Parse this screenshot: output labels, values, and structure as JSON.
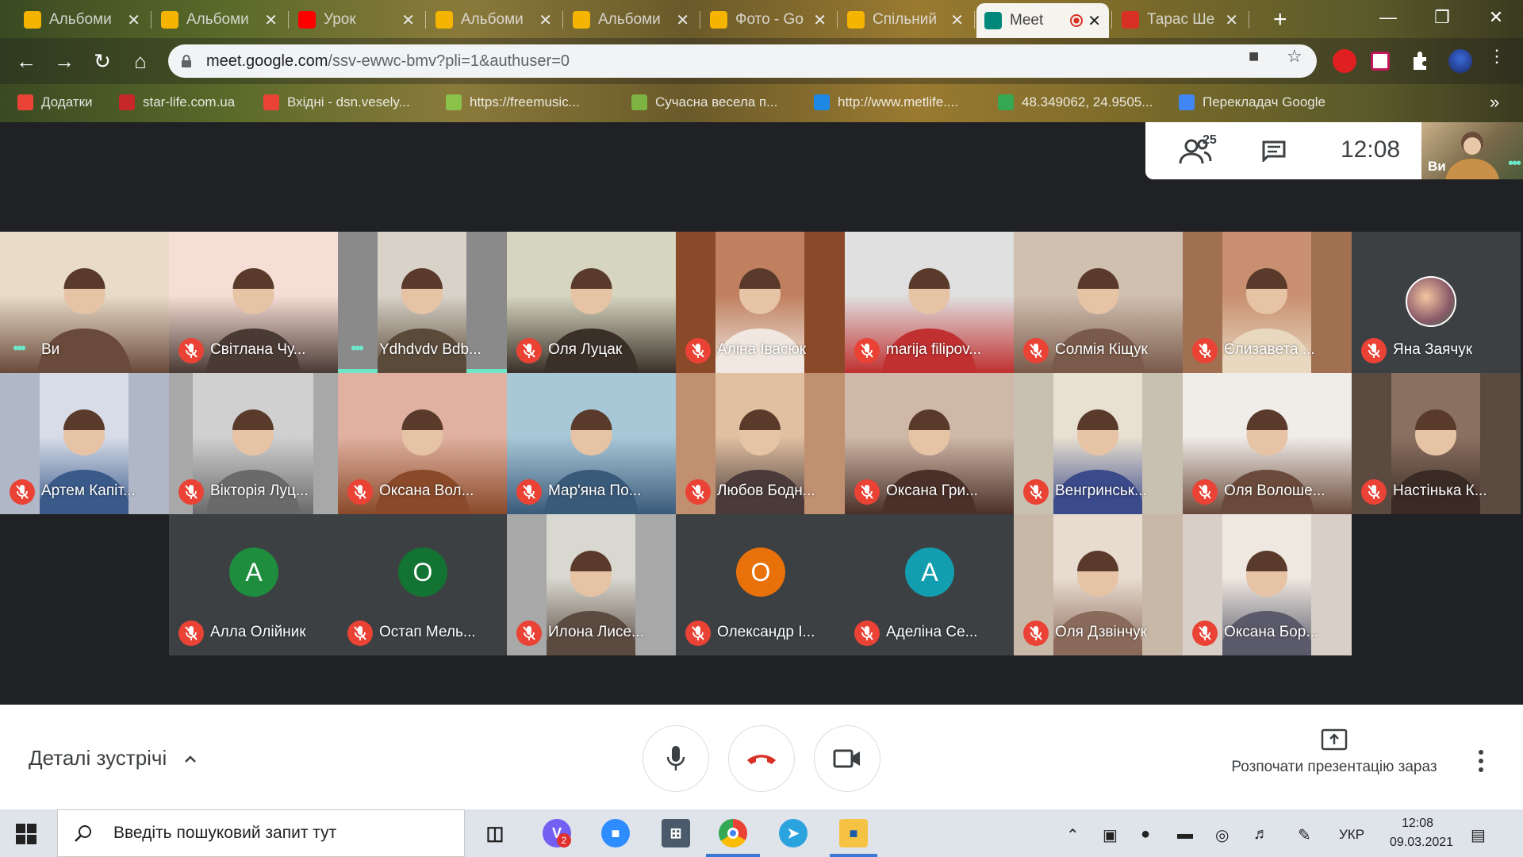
{
  "browser": {
    "tabs": [
      {
        "title": "Альбоми",
        "color": "#f4b400"
      },
      {
        "title": "Альбоми",
        "color": "#f4b400"
      },
      {
        "title": "Урок",
        "color": "#ff0000"
      },
      {
        "title": "Альбоми",
        "color": "#f4b400"
      },
      {
        "title": "Альбоми",
        "color": "#f4b400"
      },
      {
        "title": "Фото - Go",
        "color": "#f4b400"
      },
      {
        "title": "Спільний",
        "color": "#f4b400"
      },
      {
        "title": "Meet",
        "color": "#00897b"
      },
      {
        "title": "Тарас Ше",
        "color": "#d93025"
      }
    ],
    "url_host": "meet.google.com",
    "url_path": "/ssv-ewwc-bmv?pli=1&authuser=0",
    "bookmarks": [
      {
        "label": "Додатки",
        "color": "#ea4335"
      },
      {
        "label": "star-life.com.ua",
        "color": "#c62828"
      },
      {
        "label": "Вхідні - dsn.vesely...",
        "color": "#ea4335"
      },
      {
        "label": "https://freemusic...",
        "color": "#8bc34a"
      },
      {
        "label": "Сучасна весела п...",
        "color": "#7cb342"
      },
      {
        "label": "http://www.metlife....",
        "color": "#1e88e5"
      },
      {
        "label": "48.349062, 24.9505...",
        "color": "#34a853"
      },
      {
        "label": "Перекладач Google",
        "color": "#4285f4"
      }
    ],
    "bookmarks_more": "»"
  },
  "meet": {
    "participant_count": "25",
    "time": "12:08",
    "self_label": "Ви",
    "tiles": [
      {
        "name": "Ви",
        "muted": false,
        "self": true,
        "bg": "#b9a78a",
        "vw": 213,
        "vx": 0,
        "c1": "#e8dcc8",
        "c2": "#6a4a3a"
      },
      {
        "name": "Світлана Чу...",
        "muted": true,
        "bg": "#f0d2cc",
        "vw": 213,
        "vx": 0,
        "c1": "#f6ded6",
        "c2": "#4a3a34"
      },
      {
        "name": "Ydhdvdv Bdb...",
        "muted": false,
        "speaking": true,
        "bg": "#8a8a8a",
        "vw": 112,
        "vx": 50,
        "c1": "#d8d2c8",
        "c2": "#5a4a3a"
      },
      {
        "name": "Оля Луцак",
        "muted": true,
        "bg": "#c8c8b0",
        "vw": 213,
        "vx": 0,
        "c1": "#d6d6c0",
        "c2": "#3a3028"
      },
      {
        "name": "Аліна Івасюк",
        "muted": true,
        "bg": "#8a4a2a",
        "vw": 112,
        "vx": 50,
        "c1": "#c08060",
        "c2": "#f0e8e0"
      },
      {
        "name": "marija filipov...",
        "muted": true,
        "bg": "#d0d0d0",
        "vw": 213,
        "vx": 0,
        "c1": "#e0e0e0",
        "c2": "#c03030"
      },
      {
        "name": "Солмія Кіщук",
        "muted": true,
        "bg": "#b8a898",
        "vw": 213,
        "vx": 0,
        "c1": "#d0c0b0",
        "c2": "#7a5a4a"
      },
      {
        "name": "Єлизавета ...",
        "muted": true,
        "bg": "#a07050",
        "vw": 112,
        "vx": 50,
        "c1": "#c89070",
        "c2": "#e8d8c0"
      },
      {
        "name": "Яна Заячук",
        "muted": true,
        "avatar_photo": true,
        "bg": "#3c4043"
      },
      {
        "name": "Артем Капіт...",
        "muted": true,
        "bg": "#b0b8c8",
        "vw": 112,
        "vx": 50,
        "c1": "#d8dce8",
        "c2": "#3a5a8a"
      },
      {
        "name": "Вікторія Луц...",
        "muted": true,
        "bg": "#a8a8a8",
        "vw": 152,
        "vx": 30,
        "c1": "#d0d0d0",
        "c2": "#6a6a6a"
      },
      {
        "name": "Оксана Вол...",
        "muted": true,
        "bg": "#c08070",
        "vw": 213,
        "vx": 0,
        "c1": "#e0b0a0",
        "c2": "#8a4a2a"
      },
      {
        "name": "Мар'яна По...",
        "muted": true,
        "bg": "#6a8aa8",
        "vw": 213,
        "vx": 0,
        "c1": "#a8c8d8",
        "c2": "#3a5a7a"
      },
      {
        "name": "Любов Бодн...",
        "muted": true,
        "bg": "#c09070",
        "vw": 112,
        "vx": 50,
        "c1": "#e0c0a0",
        "c2": "#4a3a3a"
      },
      {
        "name": "Оксана Гри...",
        "muted": true,
        "bg": "#8a6a5a",
        "vw": 213,
        "vx": 0,
        "c1": "#d0b8a8",
        "c2": "#4a3028"
      },
      {
        "name": "Венгринськ...",
        "muted": true,
        "bg": "#c8c0b0",
        "vw": 112,
        "vx": 50,
        "c1": "#e8e0d0",
        "c2": "#3a4a8a"
      },
      {
        "name": "Оля Волоше...",
        "muted": true,
        "bg": "#d8d0c8",
        "vw": 213,
        "vx": 0,
        "c1": "#f0ece8",
        "c2": "#6a4a3a"
      },
      {
        "name": "Настінька К...",
        "muted": true,
        "bg": "#5a4a40",
        "vw": 112,
        "vx": 50,
        "c1": "#8a7060",
        "c2": "#3a2a24"
      },
      {
        "name": "Алла Олійник",
        "muted": true,
        "avatar": "A",
        "avatar_color": "#1e8e3e",
        "bg": "#3c4043"
      },
      {
        "name": "Остап Мель...",
        "muted": true,
        "avatar": "O",
        "avatar_color": "#137333",
        "bg": "#3c4043"
      },
      {
        "name": "Илона Лисе...",
        "muted": true,
        "bg": "#a8a8a8",
        "vw": 112,
        "vx": 50,
        "c1": "#d8d8d0",
        "c2": "#5a4a40"
      },
      {
        "name": "Олександр І...",
        "muted": true,
        "avatar": "O",
        "avatar_color": "#e8710a",
        "bg": "#3c4043"
      },
      {
        "name": "Аделіна Се...",
        "muted": true,
        "avatar": "A",
        "avatar_color": "#129eaf",
        "bg": "#3c4043"
      },
      {
        "name": "Оля Дзвінчук",
        "muted": true,
        "bg": "#c8b8a8",
        "vw": 112,
        "vx": 50,
        "c1": "#e8dcd0",
        "c2": "#8a6a5a"
      },
      {
        "name": "Оксана Бор...",
        "muted": true,
        "bg": "#d8d0c8",
        "vw": 112,
        "vx": 50,
        "c1": "#eee8e0",
        "c2": "#5a5a6a"
      }
    ]
  },
  "controls": {
    "meeting_details": "Деталі зустрічі",
    "present_label": "Розпочати презентацію зараз",
    "end_call_color": "#d93025"
  },
  "taskbar": {
    "search_placeholder": "Введіть пошуковий запит тут",
    "viber_badge": "2",
    "lang": "УКР",
    "clock_time": "12:08",
    "clock_date": "09.03.2021"
  }
}
